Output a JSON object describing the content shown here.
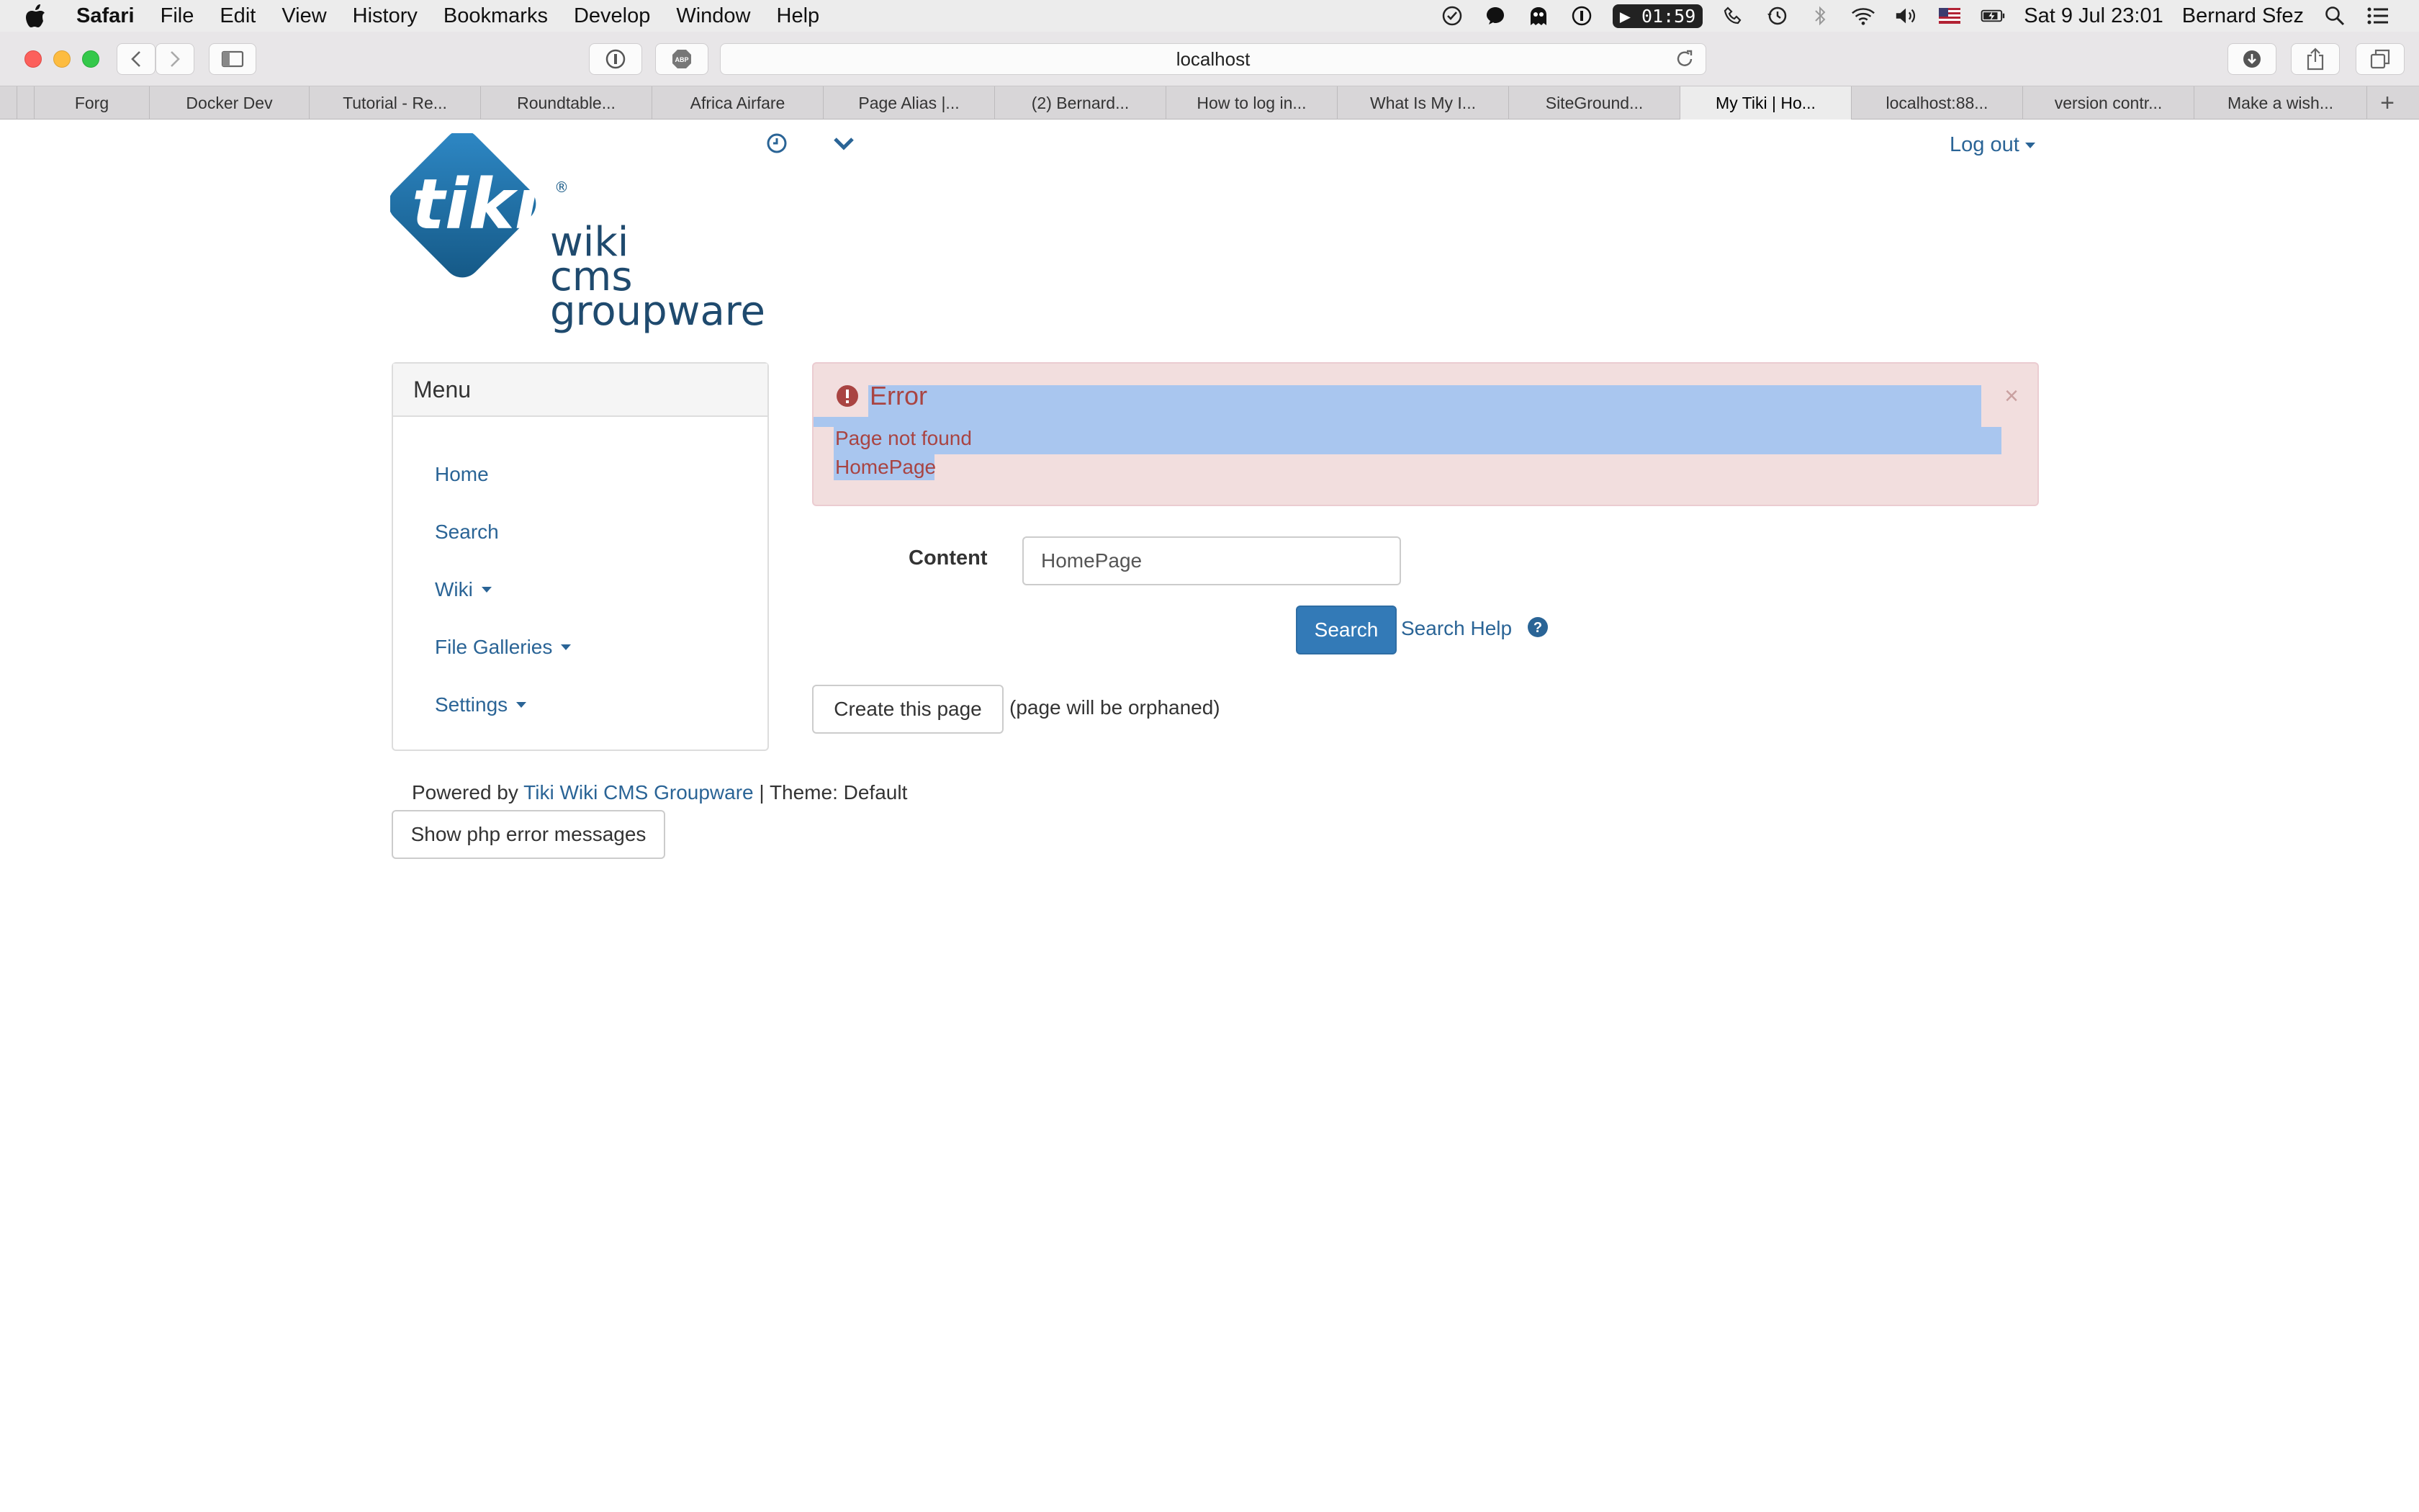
{
  "menubar": {
    "app": "Safari",
    "items": [
      "File",
      "Edit",
      "View",
      "History",
      "Bookmarks",
      "Develop",
      "Window",
      "Help"
    ],
    "timer": "01:59",
    "datetime": "Sat 9 Jul  23:01",
    "user": "Bernard Sfez"
  },
  "browser": {
    "url": "localhost",
    "tabs": [
      {
        "label": "Forg"
      },
      {
        "label": "Docker Dev"
      },
      {
        "label": "Tutorial - Re..."
      },
      {
        "label": "Roundtable..."
      },
      {
        "label": "Africa Airfare"
      },
      {
        "label": "Page Alias |..."
      },
      {
        "label": "(2) Bernard..."
      },
      {
        "label": "How to log in..."
      },
      {
        "label": "What Is My I..."
      },
      {
        "label": "SiteGround..."
      },
      {
        "label": "My Tiki | Ho..."
      },
      {
        "label": "localhost:88..."
      },
      {
        "label": "version contr..."
      },
      {
        "label": "Make a wish..."
      }
    ],
    "new_tab": "+"
  },
  "header": {
    "logo_text": [
      "tiki",
      "wiki",
      "cms",
      "groupware"
    ],
    "logout_label": "Log out"
  },
  "menu": {
    "title": "Menu",
    "items": [
      "Home",
      "Search",
      "Wiki",
      "File Galleries",
      "Settings"
    ]
  },
  "error": {
    "title": "Error",
    "message": "Page not found",
    "page_name": "HomePage",
    "close": "×"
  },
  "search_form": {
    "label": "Content",
    "value": "HomePage",
    "button": "Search",
    "help_link": "Search Help"
  },
  "create": {
    "button": "Create this page",
    "note": "(page will be orphaned)"
  },
  "footer": {
    "powered_by": "Powered by",
    "link": "Tiki Wiki CMS Groupware",
    "theme": "| Theme: Default",
    "php_button": "Show php error messages"
  }
}
